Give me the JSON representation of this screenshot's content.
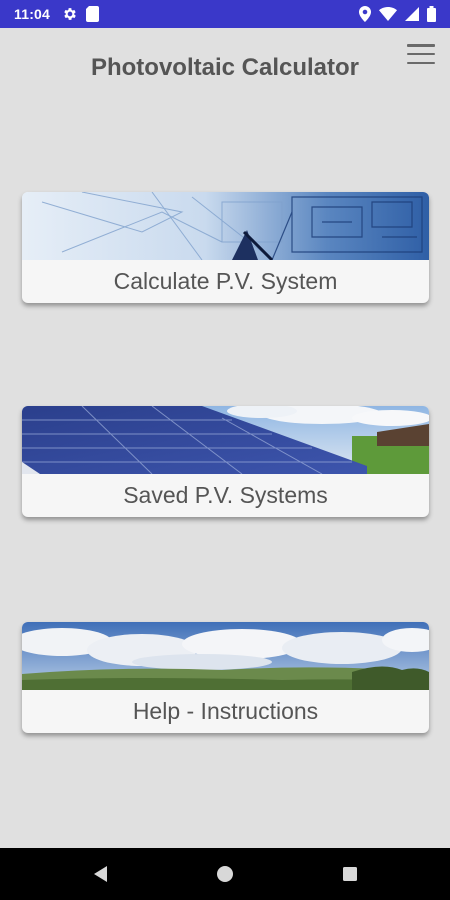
{
  "status_bar": {
    "time": "11:04",
    "left_icons": [
      "gear-icon",
      "sd-card-icon"
    ],
    "right_icons": [
      "location-icon",
      "wifi-icon",
      "signal-icon",
      "battery-icon"
    ],
    "background_color": "#3a38c9"
  },
  "header": {
    "title": "Photovoltaic Calculator",
    "menu_icon": "hamburger-menu-icon"
  },
  "cards": [
    {
      "id": "calculate",
      "label": "Calculate P.V. System",
      "image": "blueprint-image"
    },
    {
      "id": "saved",
      "label": "Saved P.V. Systems",
      "image": "solar-panels-image"
    },
    {
      "id": "help",
      "label": "Help - Instructions",
      "image": "landscape-image"
    }
  ],
  "nav_bar": {
    "buttons": [
      "back-icon",
      "home-icon",
      "recent-apps-icon"
    ]
  },
  "colors": {
    "background": "#e0e0e0",
    "card_background": "#f6f6f6",
    "text": "#555555"
  }
}
